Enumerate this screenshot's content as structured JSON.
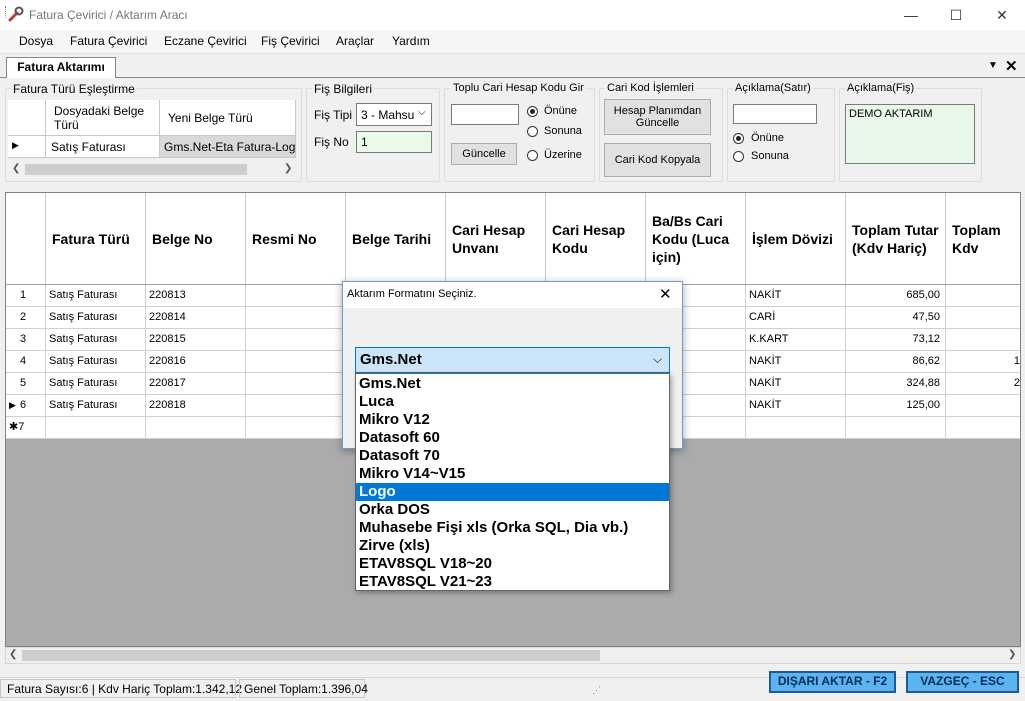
{
  "window": {
    "title": "Fatura Çevirici / Aktarım Aracı",
    "minimize": "—",
    "maximize": "☐",
    "close": "✕"
  },
  "menu": [
    "Dosya",
    "Fatura Çevirici",
    "Eczane Çevirici",
    "Fiş Çevirici",
    "Araçlar",
    "Yardım"
  ],
  "tab": {
    "label": "Fatura Aktarımı",
    "dropdown": "▼",
    "close": "✕"
  },
  "fatura_turu": {
    "title": "Fatura Türü Eşleştirme",
    "col1": "Dosyadaki Belge Türü",
    "col2": "Yeni Belge Türü",
    "row_marker": "▶",
    "row_source": "Satış Faturası",
    "row_target": "Gms.Net-Eta Fatura-Log"
  },
  "fis_bilgileri": {
    "title": "Fiş Bilgileri",
    "tip_label": "Fiş Tipi",
    "tip_value": "3 - Mahsu",
    "no_label": "Fiş No",
    "no_value": "1"
  },
  "toplu_cari": {
    "title": "Toplu Cari Hesap Kodu Gir",
    "input_value": "",
    "update_button": "Güncelle",
    "options": [
      "Önüne",
      "Sonuna",
      "Üzerine"
    ],
    "selected": 0
  },
  "cari_kod": {
    "title": "Cari Kod İşlemleri",
    "update_button": "Hesap Planımdan Güncelle",
    "copy_button": "Cari Kod Kopyala"
  },
  "aciklama_satir": {
    "title": "Açıklama(Satır)",
    "input_value": "",
    "options": [
      "Önüne",
      "Sonuna"
    ],
    "selected": 0
  },
  "aciklama_fis": {
    "title": "Açıklama(Fiş)",
    "value": "DEMO AKTARIM"
  },
  "grid": {
    "headers": [
      "Fatura Türü",
      "Belge No",
      "Resmi No",
      "Belge Tarihi",
      "Cari Hesap Unvanı",
      "Cari Hesap Kodu",
      "Ba/Bs Cari Kodu (Luca için)",
      "İşlem Dövizi",
      "Toplam Tutar (Kdv Hariç)",
      "Toplam Kdv"
    ],
    "rows": [
      {
        "num": "1",
        "marker": "",
        "type": "Satış Faturası",
        "belge": "220813",
        "doviz": "NAKİT",
        "tutar": "685,00",
        "kdv": ""
      },
      {
        "num": "2",
        "marker": "",
        "type": "Satış Faturası",
        "belge": "220814",
        "doviz": "CARİ",
        "tutar": "47,50",
        "kdv": ""
      },
      {
        "num": "3",
        "marker": "",
        "type": "Satış Faturası",
        "belge": "220815",
        "doviz": "K.KART",
        "tutar": "73,12",
        "kdv": ""
      },
      {
        "num": "4",
        "marker": "",
        "type": "Satış Faturası",
        "belge": "220816",
        "doviz": "NAKİT",
        "tutar": "86,62",
        "kdv": "1"
      },
      {
        "num": "5",
        "marker": "",
        "type": "Satış Faturası",
        "belge": "220817",
        "doviz": "NAKİT",
        "tutar": "324,88",
        "kdv": "2"
      },
      {
        "num": "6",
        "marker": "▶",
        "type": "Satış Faturası",
        "belge": "220818",
        "doviz": "NAKİT",
        "tutar": "125,00",
        "kdv": ""
      }
    ],
    "new_row_marker": "✱7"
  },
  "dialog": {
    "title": "Aktarım Formatını Seçiniz.",
    "close": "✕",
    "selected_value": "Gms.Net",
    "options": [
      "Gms.Net",
      "Luca",
      "Mikro V12",
      "Datasoft 60",
      "Datasoft 70",
      "Mikro V14~V15",
      "Logo",
      "Orka DOS",
      "Muhasebe Fişi xls (Orka SQL, Dia vb.)",
      "Zirve (xls)",
      "ETAV8SQL V18~20",
      "ETAV8SQL V21~23"
    ],
    "highlighted_index": 6
  },
  "status": {
    "summary": "Fatura Sayısı:6 | Kdv Hariç Toplam:1.342,12",
    "total": "Genel Toplam:1.396,04",
    "export_button": "DIŞARI AKTAR - F2",
    "cancel_button": "VAZGEÇ - ESC"
  },
  "colors": {
    "accent": "#0078d7",
    "status_button": "#5ab4f0",
    "note_field": "#e8f8e8"
  }
}
